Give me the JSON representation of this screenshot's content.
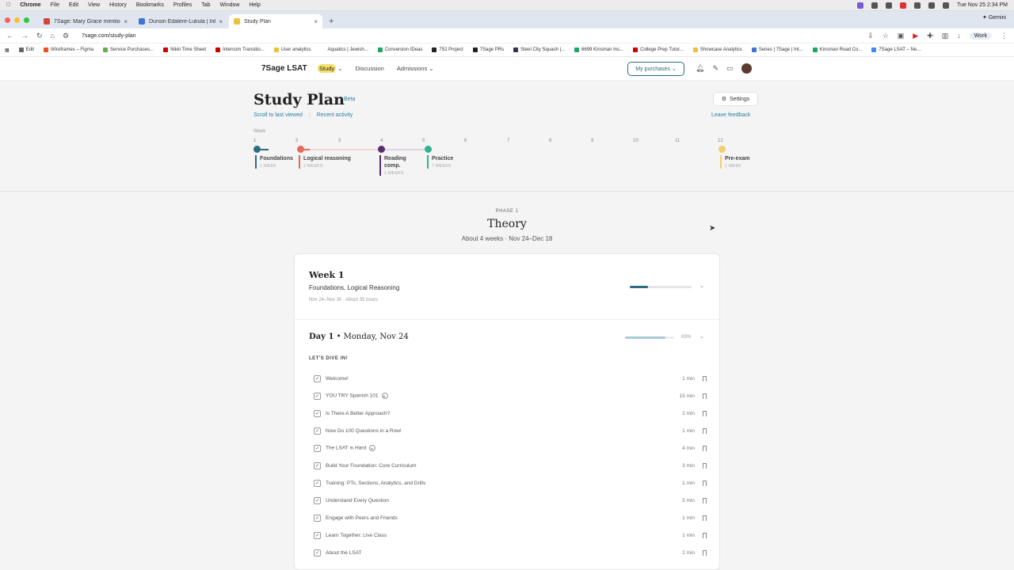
{
  "os": {
    "menu": [
      "Chrome",
      "File",
      "Edit",
      "View",
      "History",
      "Bookmarks",
      "Profiles",
      "Tab",
      "Window",
      "Help"
    ],
    "clock": "Tue Nov 25  2:34 PM"
  },
  "browser": {
    "tabs": [
      {
        "label": "7Sage: Mary Grace mentione"
      },
      {
        "label": "Dunsin Edalere-Lukula | Inbo"
      },
      {
        "label": "Study Plan"
      }
    ],
    "gemini": "Gemini",
    "url": "7sage.com/study-plan",
    "profile": "Work",
    "bookmarks": [
      "Edit",
      "Wireframes – Figma",
      "Service Purchases...",
      "Nikki Time Sheet",
      "Intercom Transitio...",
      "User analytics",
      "Aquatics | Jewish...",
      "Conversion IDeas",
      "752 Project",
      "7Sage PRs",
      "Steel City Squash |...",
      "6699 Kinsman Ins...",
      "College Prep Tutor...",
      "Showcase Analytics",
      "Series | 7Sage | Int...",
      "Kinsman Road Co...",
      "7Sage LSAT – Ne..."
    ]
  },
  "sitenav": {
    "logo": "7Sage LSAT",
    "study": "Study",
    "discussion": "Discussion",
    "admissions": "Admissions",
    "purchases": "My purchases"
  },
  "header": {
    "title": "Study Plan",
    "beta": "Beta",
    "scroll_link": "Scroll to last viewed",
    "recent_link": "Recent activity",
    "settings": "Settings",
    "feedback": "Leave feedback",
    "week_label": "Week",
    "weeks": [
      "1",
      "2",
      "3",
      "4",
      "5",
      "6",
      "7",
      "8",
      "9",
      "10",
      "11",
      "12"
    ],
    "phases": [
      {
        "name": "Foundations",
        "duration": "1 WEEK",
        "color": "#2c6b82"
      },
      {
        "name": "Logical reasoning",
        "duration": "2 WEEKS",
        "color": "#e46a5a"
      },
      {
        "name": "Reading comp.",
        "duration": "1 WEEKS",
        "color": "#5a2d6b"
      },
      {
        "name": "Practice",
        "duration": "7 WEEKS",
        "color": "#2bb58f"
      },
      {
        "name": "Pre-exam",
        "duration": "1 WEEK",
        "color": "#f4d06a"
      }
    ]
  },
  "main": {
    "phase_label": "PHASE 1",
    "phase_title": "Theory",
    "phase_dates": "About 4 weeks · Nov 24–Dec 18",
    "week": {
      "title": "Week 1",
      "subtitle": "Foundations, Logical Reasoning",
      "meta": "Nov 24–Nov 30 · About 35 hours",
      "progress": 0.3
    },
    "day": {
      "name": "Day 1",
      "date": " • Monday, Nov 24",
      "percent": "83%",
      "progress": 0.83
    },
    "section": "LET'S DIVE IN!",
    "lessons": [
      {
        "title": "Welcome!",
        "duration": "1 min"
      },
      {
        "title": "YOU TRY Spanish 101",
        "duration": "15 min",
        "video": true
      },
      {
        "title": "Is There A Better Approach?",
        "duration": "2 min"
      },
      {
        "title": "Now Do 100 Questions in a Row!",
        "duration": "1 min"
      },
      {
        "title": "The LSAT is Hard",
        "duration": "4 min",
        "video": true
      },
      {
        "title": "Build Your Foundation: Core Curriculum",
        "duration": "3 min"
      },
      {
        "title": "Training: PTs, Sections, Analytics, and Drills",
        "duration": "1 min"
      },
      {
        "title": "Understand Every Question",
        "duration": "5 min"
      },
      {
        "title": "Engage with Peers and Friends",
        "duration": "1 min"
      },
      {
        "title": "Learn Together: Live Class",
        "duration": "1 min"
      },
      {
        "title": "About the LSAT",
        "duration": "2 min"
      }
    ]
  }
}
